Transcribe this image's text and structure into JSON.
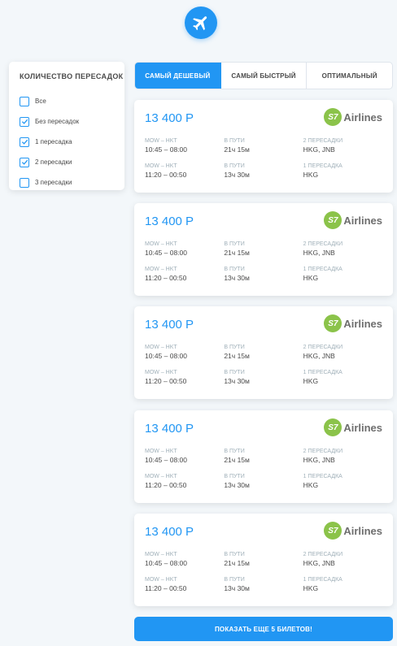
{
  "filter": {
    "title": "Количество пересадок",
    "options": [
      {
        "label": "Все",
        "checked": false
      },
      {
        "label": "Без пересадок",
        "checked": true
      },
      {
        "label": "1 пересадка",
        "checked": true
      },
      {
        "label": "2 пересадки",
        "checked": true
      },
      {
        "label": "3 пересадки",
        "checked": false
      }
    ]
  },
  "tabs": [
    {
      "label": "Самый дешевый",
      "active": true
    },
    {
      "label": "Самый быстрый",
      "active": false
    },
    {
      "label": "Оптимальный",
      "active": false
    }
  ],
  "colors": {
    "accent": "#2196f3",
    "s7": "#8bc34a"
  },
  "tickets": [
    {
      "price": "13 400 Р",
      "carrier_code": "S7",
      "carrier_name": "Airlines",
      "segments": [
        {
          "route": "MOW – HKT",
          "time": "10:45 – 08:00",
          "duration_label": "В пути",
          "duration": "21ч 15м",
          "stops_label": "2 пересадки",
          "stops": "HKG, JNB"
        },
        {
          "route": "MOW – HKT",
          "time": "11:20 – 00:50",
          "duration_label": "В пути",
          "duration": "13ч 30м",
          "stops_label": "1 пересадка",
          "stops": "HKG"
        }
      ]
    },
    {
      "price": "13 400 Р",
      "carrier_code": "S7",
      "carrier_name": "Airlines",
      "segments": [
        {
          "route": "MOW – HKT",
          "time": "10:45 – 08:00",
          "duration_label": "В пути",
          "duration": "21ч 15м",
          "stops_label": "2 пересадки",
          "stops": "HKG, JNB"
        },
        {
          "route": "MOW – HKT",
          "time": "11:20 – 00:50",
          "duration_label": "В пути",
          "duration": "13ч 30м",
          "stops_label": "1 пересадка",
          "stops": "HKG"
        }
      ]
    },
    {
      "price": "13 400 Р",
      "carrier_code": "S7",
      "carrier_name": "Airlines",
      "segments": [
        {
          "route": "MOW – HKT",
          "time": "10:45 – 08:00",
          "duration_label": "В пути",
          "duration": "21ч 15м",
          "stops_label": "2 пересадки",
          "stops": "HKG, JNB"
        },
        {
          "route": "MOW – HKT",
          "time": "11:20 – 00:50",
          "duration_label": "В пути",
          "duration": "13ч 30м",
          "stops_label": "1 пересадка",
          "stops": "HKG"
        }
      ]
    },
    {
      "price": "13 400 Р",
      "carrier_code": "S7",
      "carrier_name": "Airlines",
      "segments": [
        {
          "route": "MOW – HKT",
          "time": "10:45 – 08:00",
          "duration_label": "В пути",
          "duration": "21ч 15м",
          "stops_label": "2 пересадки",
          "stops": "HKG, JNB"
        },
        {
          "route": "MOW – HKT",
          "time": "11:20 – 00:50",
          "duration_label": "В пути",
          "duration": "13ч 30м",
          "stops_label": "1 пересадка",
          "stops": "HKG"
        }
      ]
    },
    {
      "price": "13 400 Р",
      "carrier_code": "S7",
      "carrier_name": "Airlines",
      "segments": [
        {
          "route": "MOW – HKT",
          "time": "10:45 – 08:00",
          "duration_label": "В пути",
          "duration": "21ч 15м",
          "stops_label": "2 пересадки",
          "stops": "HKG, JNB"
        },
        {
          "route": "MOW – HKT",
          "time": "11:20 – 00:50",
          "duration_label": "В пути",
          "duration": "13ч 30м",
          "stops_label": "1 пересадка",
          "stops": "HKG"
        }
      ]
    }
  ],
  "more_button": "Показать еще 5 билетов!"
}
